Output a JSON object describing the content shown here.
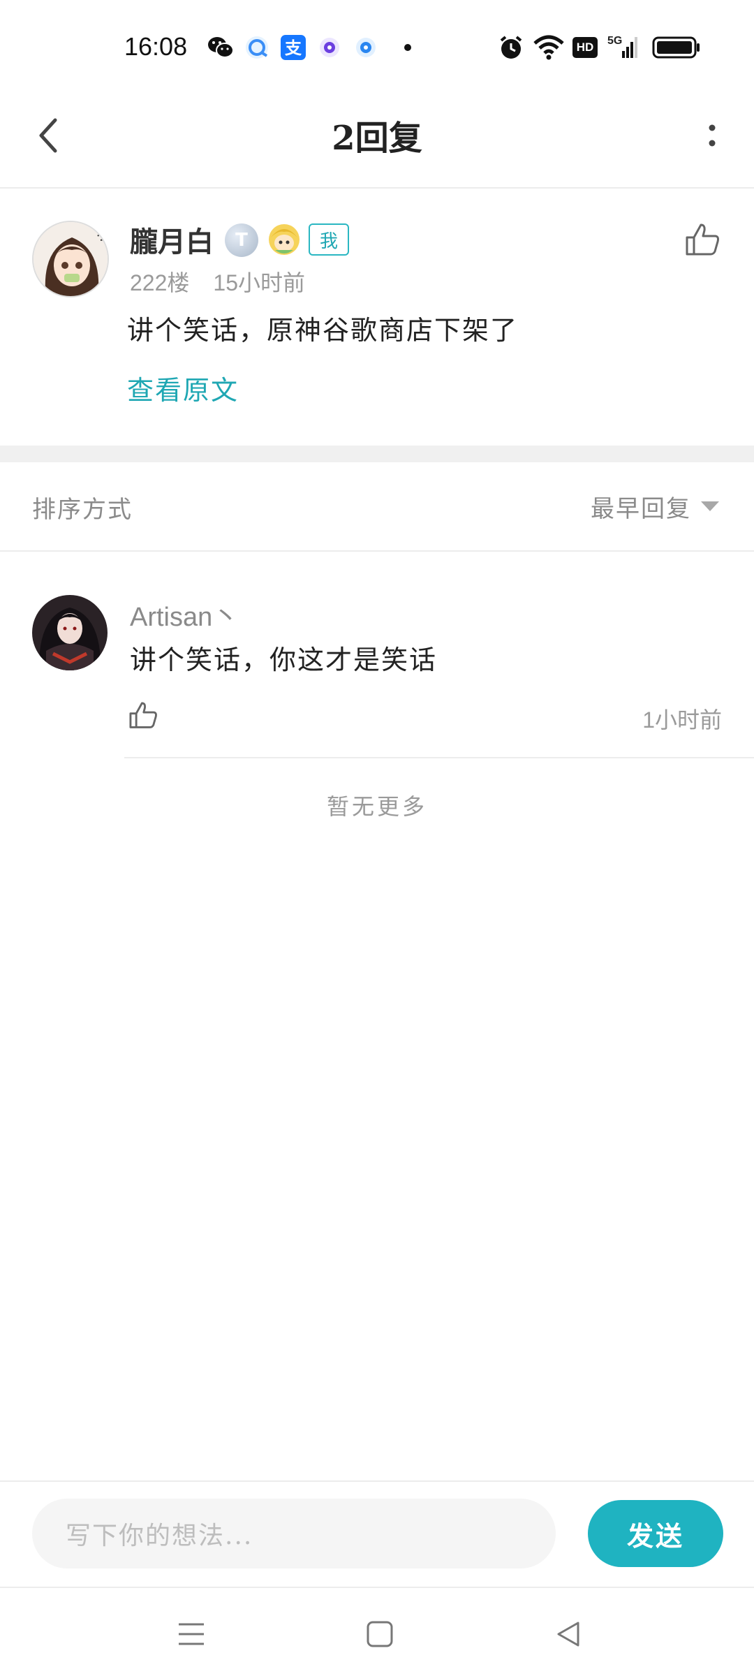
{
  "status_bar": {
    "time": "16:08",
    "left_icons": [
      "wechat-icon",
      "browser-icon",
      "alipay-icon",
      "app-icon",
      "app2-icon",
      "dot-icon"
    ],
    "right_icons": [
      "alarm-icon",
      "wifi-icon",
      "hd-icon",
      "5g-signal-icon",
      "battery-icon"
    ],
    "hd_label": "HD",
    "network_label": "5G"
  },
  "nav": {
    "title": "2回复",
    "back_icon": "chevron-left-icon",
    "more_icon": "more-vertical-icon"
  },
  "original_comment": {
    "username": "朧月白",
    "badge_level": "T",
    "me_tag": "我",
    "floor": "222楼",
    "time": "15小时前",
    "text": "讲个笑话，原神谷歌商店下架了",
    "view_original": "查看原文"
  },
  "sort": {
    "label": "排序方式",
    "selected": "最早回复"
  },
  "replies": [
    {
      "username": "Artisan丶",
      "text": "讲个笑话，你这才是笑话",
      "time": "1小时前"
    }
  ],
  "no_more": "暂无更多",
  "composer": {
    "placeholder": "写下你的想法...",
    "send_label": "发送"
  },
  "colors": {
    "accent": "#1fb3c1",
    "muted_text": "#9a9a9a",
    "divider": "#ececec"
  }
}
